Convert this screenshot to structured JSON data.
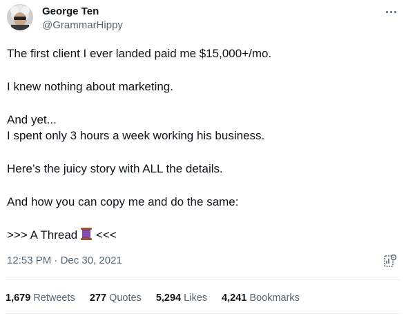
{
  "author": {
    "name": "George Ten",
    "handle": "@GrammarHippy"
  },
  "tweet": {
    "lines": {
      "l1": "The first client I ever landed paid me $15,000+/mo.",
      "l2": "I knew nothing about marketing.",
      "l3": "And yet...",
      "l4": "I spent only 3 hours a week working his business.",
      "l5": "Here’s the juicy story with ALL the details.",
      "l6": "And how you can copy me and do the same:",
      "l7_pre": ">>> A Thread",
      "l7_post": "<<<"
    },
    "emoji": "spool-of-thread-icon"
  },
  "meta": {
    "time": "12:53 PM",
    "separator": " · ",
    "date": "Dec 30, 2021"
  },
  "stats": {
    "retweets": {
      "count": "1,679",
      "label": "Retweets"
    },
    "quotes": {
      "count": "277",
      "label": "Quotes"
    },
    "likes": {
      "count": "5,294",
      "label": "Likes"
    },
    "bookmarks": {
      "count": "4,241",
      "label": "Bookmarks"
    }
  },
  "colors": {
    "text": "#0f1419",
    "secondary": "#536471",
    "divider": "#eff3f4",
    "spool": "#7b3fa0"
  }
}
